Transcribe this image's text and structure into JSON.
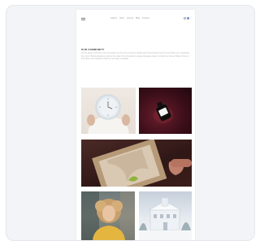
{
  "nav": {
    "links": [
      "Gallery",
      "Shop",
      "Journal",
      "Blog",
      "Contact"
    ]
  },
  "intro": {
    "title": "OUR COMMUNITY",
    "body": "Far far away, behind the word mountains, far from the countries Vokalia and Consonantia, there live the blind texts. Separated they live in Bookmarksgrove right at the coast of the Semantics, a large language ocean. A small river named Duden flows by their place and supplies it with the necessary regelialia."
  },
  "gallery": {
    "items": [
      {
        "name": "person-holding-clock"
      },
      {
        "name": "dark-red-bottle"
      },
      {
        "name": "hand-holding-frame"
      },
      {
        "name": "smiling-woman"
      },
      {
        "name": "snowy-building"
      }
    ]
  },
  "colors": {
    "card_bg": "#f3f4f7",
    "accent": "#6a8fd6"
  }
}
